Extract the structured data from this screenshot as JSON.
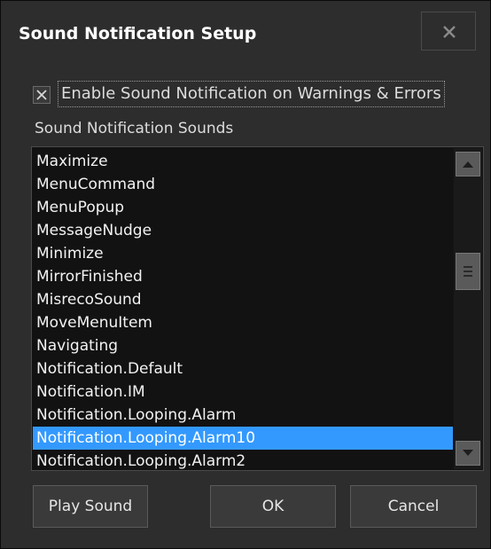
{
  "window": {
    "title": "Sound Notification Setup",
    "close_icon": "close-icon"
  },
  "enable_checkbox": {
    "label": "Enable Sound Notification on Warnings & Errors",
    "checked": true
  },
  "sounds_list": {
    "label": "Sound Notification Sounds",
    "items": [
      "Maximize",
      "MenuCommand",
      "MenuPopup",
      "MessageNudge",
      "Minimize",
      "MirrorFinished",
      "MisrecoSound",
      "MoveMenuItem",
      "Navigating",
      "Notification.Default",
      "Notification.IM",
      "Notification.Looping.Alarm",
      "Notification.Looping.Alarm10",
      "Notification.Looping.Alarm2"
    ],
    "selected": "Notification.Looping.Alarm10"
  },
  "buttons": {
    "play": "Play Sound",
    "ok": "OK",
    "cancel": "Cancel"
  },
  "colors": {
    "background": "#2d2d2d",
    "list_background": "#121212",
    "selection": "#3399ff",
    "text": "#f2f2f2"
  }
}
